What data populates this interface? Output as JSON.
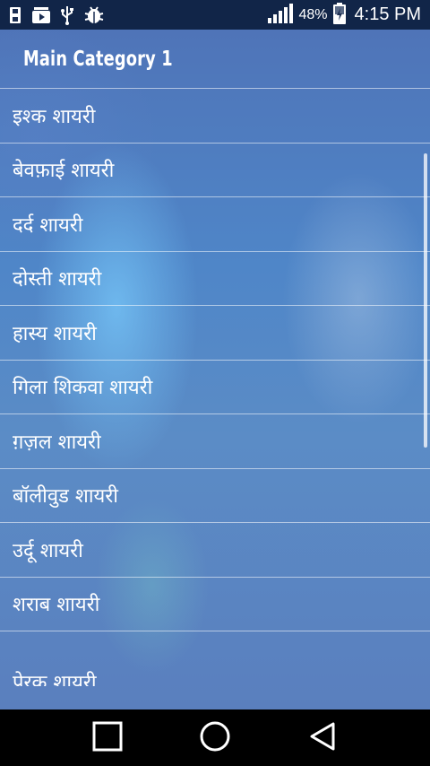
{
  "status_bar": {
    "icons": [
      "save-icon",
      "youtube-icon",
      "usb-icon",
      "android-debug-icon"
    ],
    "battery_percent": "48%",
    "time": "4:15 PM"
  },
  "header": {
    "title": "Main Category 1"
  },
  "list": {
    "items": [
      {
        "label": "इश्क शायरी"
      },
      {
        "label": "बेवफ़ाई शायरी"
      },
      {
        "label": "दर्द शायरी"
      },
      {
        "label": "दोस्ती शायरी"
      },
      {
        "label": "हास्य शायरी"
      },
      {
        "label": "गिला शिकवा शायरी"
      },
      {
        "label": "ग़ज़ल शायरी"
      },
      {
        "label": "बॉलीवुड शायरी"
      },
      {
        "label": "उर्दू शायरी"
      },
      {
        "label": "शराब शायरी"
      },
      {
        "label": "प्रेरक शायरी"
      }
    ]
  },
  "nav_bar": {
    "icons": [
      "recents-square-icon",
      "home-circle-icon",
      "back-triangle-icon"
    ]
  }
}
